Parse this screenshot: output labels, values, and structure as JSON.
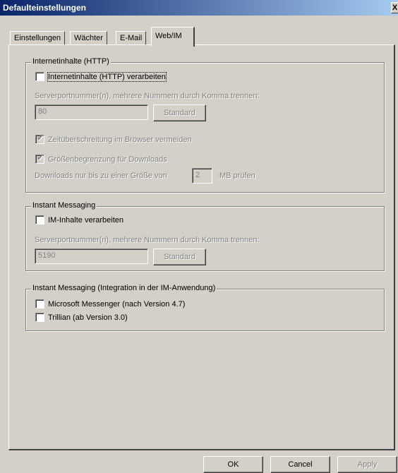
{
  "window": {
    "title": "Defaulteinstellungen",
    "close_glyph": "X"
  },
  "tabs": [
    {
      "label": "Einstellungen"
    },
    {
      "label": "Wächter"
    },
    {
      "label": "E-Mail"
    },
    {
      "label": "Web/IM"
    }
  ],
  "http": {
    "legend": "Internetinhalte (HTTP)",
    "process_label": "Internetinhalte (HTTP) verarbeiten",
    "ports_label": "Serverportnummer(n), mehrere Nummern durch Komma trennen:",
    "ports_value": "80",
    "standard_button": "Standard",
    "timeout_label": "Zeitüberschreitung im Browser vermeiden",
    "size_limit_label": "Größenbegrenzung für Downloads",
    "size_prefix": "Downloads nur bis zu einer Größe von",
    "size_value": "2",
    "size_suffix": "MB prüfen"
  },
  "im": {
    "legend": "Instant Messaging",
    "process_label": "IM-Inhalte verarbeiten",
    "ports_label": "Serverportnummer(n), mehrere Nummern durch Komma trennen:",
    "ports_value": "5190",
    "standard_button": "Standard"
  },
  "integration": {
    "legend": "Instant Messaging (Integration in der IM-Anwendung)",
    "messenger_label": "Microsoft Messenger (nach Version 4.7)",
    "trillian_label": "Trillian (ab Version 3.0)"
  },
  "buttons": {
    "ok": "OK",
    "cancel": "Cancel",
    "apply": "Apply"
  }
}
